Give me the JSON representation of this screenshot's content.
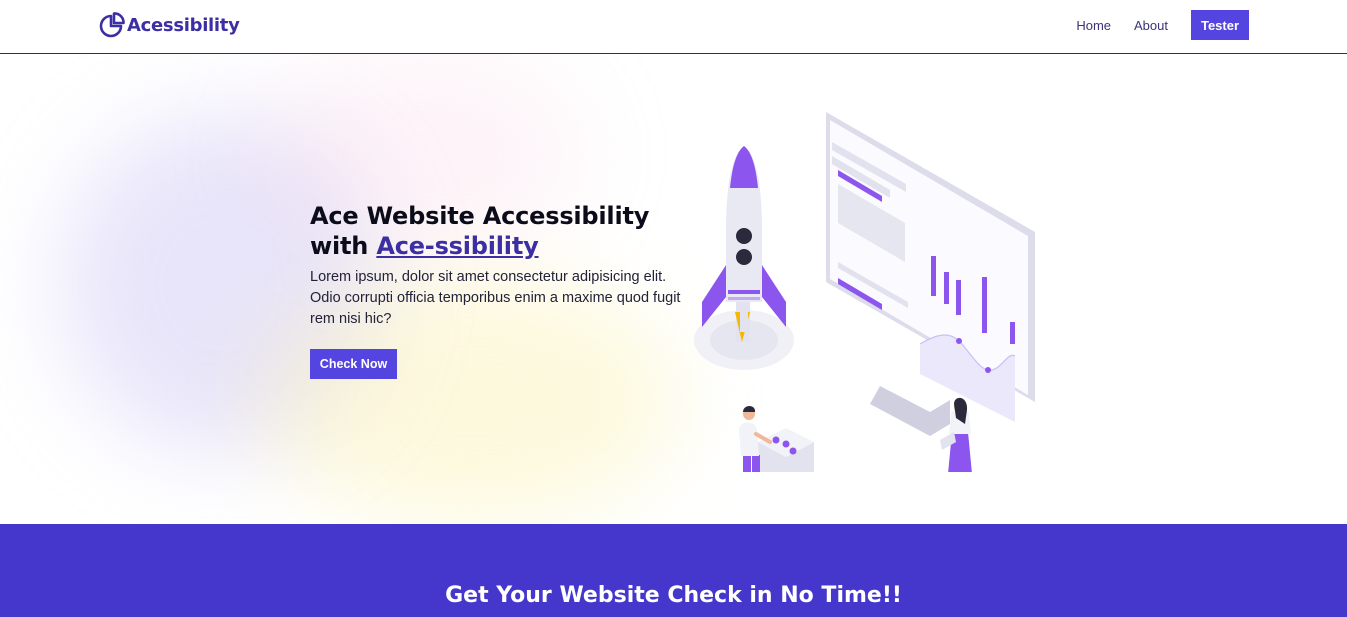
{
  "nav": {
    "brand": "Acessibility",
    "links": [
      "Home",
      "About"
    ],
    "cta": "Tester"
  },
  "hero": {
    "title_line1": "Ace Website Accessibility",
    "title_prefix": "with ",
    "title_link": "Ace-ssibility",
    "description": "Lorem ipsum, dolor sit amet consectetur adipisicing elit. Odio corrupti officia temporibus enim a maxime quod fugit rem nisi hic?",
    "button": "Check Now"
  },
  "cta_section": {
    "title": "Get Your Website Check in No Time!!"
  },
  "colors": {
    "primary": "#5445e0",
    "brand": "#3b2fa3",
    "section": "#4537cc",
    "accent_purple": "#8b55ee",
    "accent_yellow": "#f5b800"
  },
  "icons": {
    "logo": "pie-chart-icon"
  }
}
